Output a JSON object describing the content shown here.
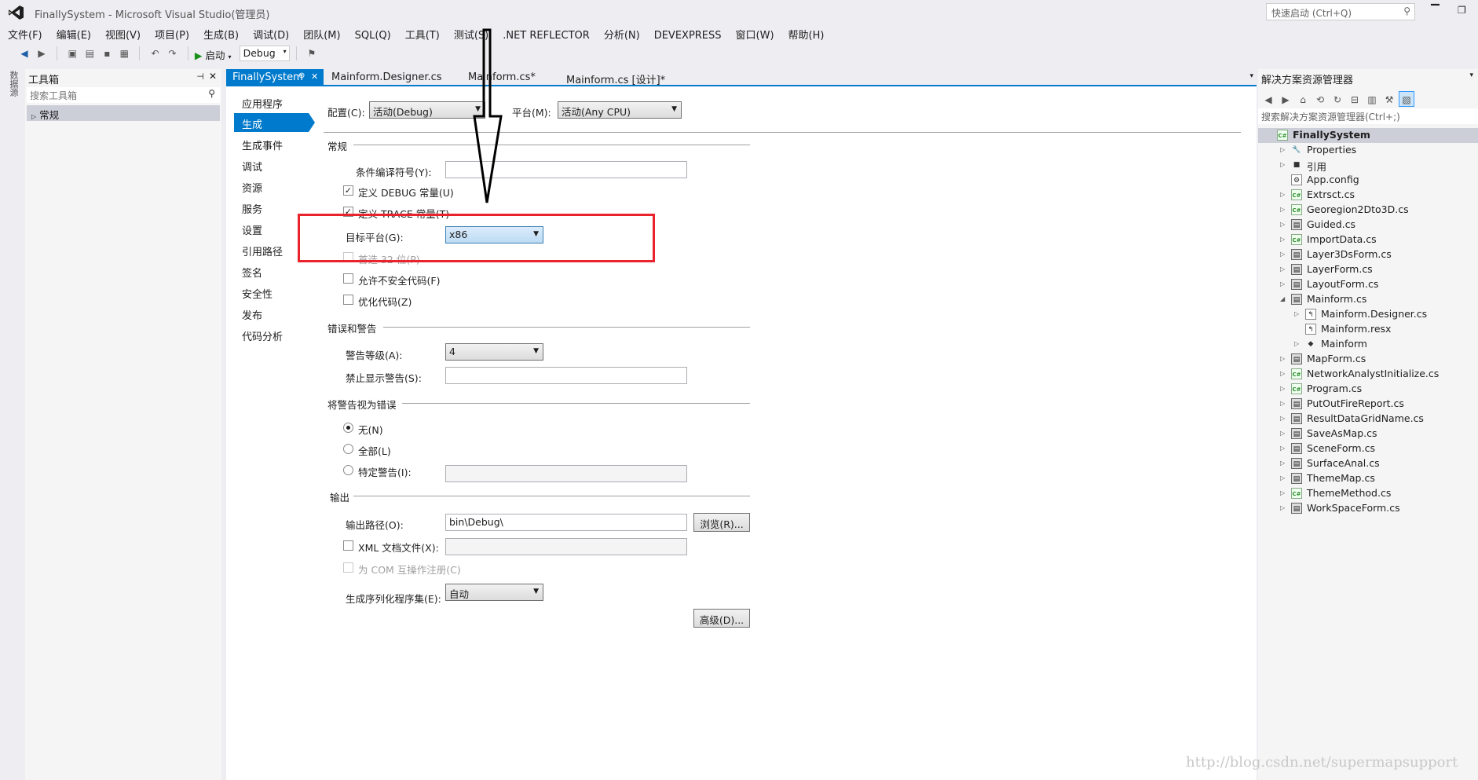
{
  "window": {
    "title": "FinallySystem - Microsoft Visual Studio(管理员)",
    "quick_launch": "快速启动 (Ctrl+Q)"
  },
  "menu": [
    "文件(F)",
    "编辑(E)",
    "视图(V)",
    "项目(P)",
    "生成(B)",
    "调试(D)",
    "团队(M)",
    "SQL(Q)",
    "工具(T)",
    "测试(S)",
    ".NET REFLECTOR",
    "分析(N)",
    "DEVEXPRESS",
    "窗口(W)",
    "帮助(H)"
  ],
  "toolbar": {
    "start_label": "启动",
    "config_value": "Debug"
  },
  "left_rail": {
    "label": "数据源"
  },
  "toolbox": {
    "title": "工具箱",
    "search_placeholder": "搜索工具箱",
    "group": "常规"
  },
  "tabs": [
    {
      "label": "FinallySystem",
      "active": true,
      "pin": "⊕",
      "close": "✕"
    },
    {
      "label": "Mainform.Designer.cs"
    },
    {
      "label": "Mainform.cs*"
    },
    {
      "label": "Mainform.cs [设计]*"
    }
  ],
  "prop_nav": [
    "应用程序",
    "生成",
    "生成事件",
    "调试",
    "资源",
    "服务",
    "设置",
    "引用路径",
    "签名",
    "安全性",
    "发布",
    "代码分析"
  ],
  "prop_nav_active": 1,
  "config": {
    "config_label": "配置(C):",
    "config_value": "活动(Debug)",
    "platform_label": "平台(M):",
    "platform_value": "活动(Any CPU)"
  },
  "general": {
    "title": "常规",
    "symbols_label": "条件编译符号(Y):",
    "define_debug": "定义 DEBUG 常量(U)",
    "define_trace": "定义 TRACE 常量(T)",
    "target_label": "目标平台(G):",
    "target_value": "x86",
    "prefer32": "首选 32 位(P)",
    "unsafe": "允许不安全代码(F)",
    "optimize": "优化代码(Z)"
  },
  "errors": {
    "title": "错误和警告",
    "level_label": "警告等级(A):",
    "level_value": "4",
    "suppress_label": "禁止显示警告(S):"
  },
  "treat": {
    "title": "将警告视为错误",
    "none": "无(N)",
    "all": "全部(L)",
    "specific": "特定警告(I):"
  },
  "output": {
    "title": "输出",
    "path_label": "输出路径(O):",
    "path_value": "bin\\Debug\\",
    "browse": "浏览(R)...",
    "xml_doc": "XML 文档文件(X):",
    "com": "为 COM 互操作注册(C)",
    "serialize_label": "生成序列化程序集(E):",
    "serialize_value": "自动",
    "advanced": "高级(D)..."
  },
  "solution": {
    "title": "解决方案资源管理器",
    "search_placeholder": "搜索解决方案资源管理器(Ctrl+;)",
    "items": [
      {
        "label": "FinallySystem",
        "level": 0,
        "icon": "project-icon",
        "exp": ""
      },
      {
        "label": "Properties",
        "level": 1,
        "icon": "wrench-icon",
        "exp": "▷"
      },
      {
        "label": "引用",
        "level": 1,
        "icon": "reference-icon",
        "exp": "▷"
      },
      {
        "label": "App.config",
        "level": 1,
        "icon": "config-file-icon",
        "exp": ""
      },
      {
        "label": "Extrsct.cs",
        "level": 1,
        "icon": "csharp-file-icon",
        "exp": "▷"
      },
      {
        "label": "Georegion2Dto3D.cs",
        "level": 1,
        "icon": "csharp-file-icon",
        "exp": "▷"
      },
      {
        "label": "Guided.cs",
        "level": 1,
        "icon": "form-icon",
        "exp": "▷"
      },
      {
        "label": "ImportData.cs",
        "level": 1,
        "icon": "csharp-file-icon",
        "exp": "▷"
      },
      {
        "label": "Layer3DsForm.cs",
        "level": 1,
        "icon": "form-icon",
        "exp": "▷"
      },
      {
        "label": "LayerForm.cs",
        "level": 1,
        "icon": "form-icon",
        "exp": "▷"
      },
      {
        "label": "LayoutForm.cs",
        "level": 1,
        "icon": "form-icon",
        "exp": "▷"
      },
      {
        "label": "Mainform.cs",
        "level": 1,
        "icon": "form-icon",
        "exp": "◢"
      },
      {
        "label": "Mainform.Designer.cs",
        "level": 2,
        "icon": "designer-file-icon",
        "exp": "▷"
      },
      {
        "label": "Mainform.resx",
        "level": 2,
        "icon": "resx-file-icon",
        "exp": ""
      },
      {
        "label": "Mainform",
        "level": 2,
        "icon": "class-icon",
        "exp": "▷"
      },
      {
        "label": "MapForm.cs",
        "level": 1,
        "icon": "form-icon",
        "exp": "▷"
      },
      {
        "label": "NetworkAnalystInitialize.cs",
        "level": 1,
        "icon": "csharp-file-icon",
        "exp": "▷"
      },
      {
        "label": "Program.cs",
        "level": 1,
        "icon": "csharp-file-icon",
        "exp": "▷"
      },
      {
        "label": "PutOutFireReport.cs",
        "level": 1,
        "icon": "form-icon",
        "exp": "▷"
      },
      {
        "label": "ResultDataGridName.cs",
        "level": 1,
        "icon": "form-icon",
        "exp": "▷"
      },
      {
        "label": "SaveAsMap.cs",
        "level": 1,
        "icon": "form-icon",
        "exp": "▷"
      },
      {
        "label": "SceneForm.cs",
        "level": 1,
        "icon": "form-icon",
        "exp": "▷"
      },
      {
        "label": "SurfaceAnal.cs",
        "level": 1,
        "icon": "form-icon",
        "exp": "▷"
      },
      {
        "label": "ThemeMap.cs",
        "level": 1,
        "icon": "form-icon",
        "exp": "▷"
      },
      {
        "label": "ThemeMethod.cs",
        "level": 1,
        "icon": "csharp-file-icon",
        "exp": "▷"
      },
      {
        "label": "WorkSpaceForm.cs",
        "level": 1,
        "icon": "form-icon",
        "exp": "▷"
      }
    ]
  },
  "watermark": "http://blog.csdn.net/supermapsupport",
  "colors": {
    "accent": "#007acc",
    "highlight": "#e8232b"
  }
}
